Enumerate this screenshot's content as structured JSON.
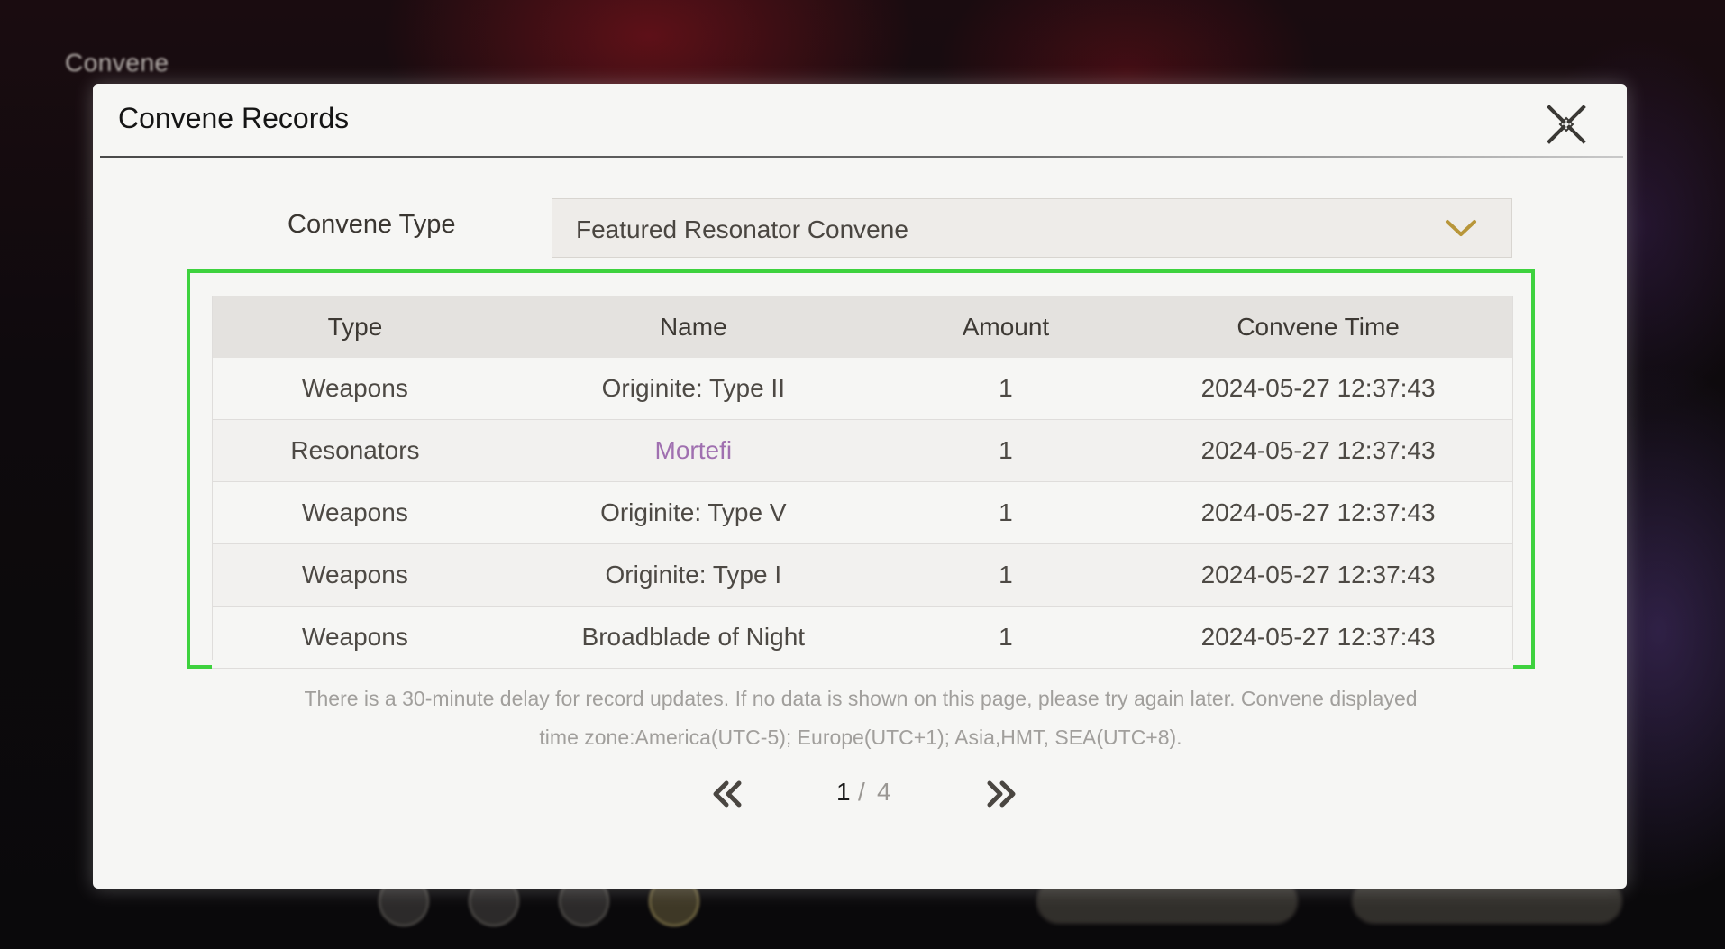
{
  "background": {
    "title": "Convene"
  },
  "dialog": {
    "title": "Convene Records",
    "close_icon": "close-icon"
  },
  "filter": {
    "label": "Convene Type",
    "selected": "Featured Resonator Convene",
    "dropdown_icon": "chevron-down-icon"
  },
  "table": {
    "columns": [
      "Type",
      "Name",
      "Amount",
      "Convene Time"
    ],
    "rows": [
      {
        "type": "Weapons",
        "name": "Originite: Type II",
        "amount": "1",
        "time": "2024-05-27 12:37:43",
        "name_color": "#4d4944"
      },
      {
        "type": "Resonators",
        "name": "Mortefi",
        "amount": "1",
        "time": "2024-05-27 12:37:43",
        "name_color": "#a070b0"
      },
      {
        "type": "Weapons",
        "name": "Originite: Type V",
        "amount": "1",
        "time": "2024-05-27 12:37:43",
        "name_color": "#4d4944"
      },
      {
        "type": "Weapons",
        "name": "Originite: Type I",
        "amount": "1",
        "time": "2024-05-27 12:37:43",
        "name_color": "#4d4944"
      },
      {
        "type": "Weapons",
        "name": "Broadblade of Night",
        "amount": "1",
        "time": "2024-05-27 12:37:43",
        "name_color": "#4d4944"
      }
    ]
  },
  "notice": {
    "line1": "There is a 30-minute delay for record updates. If no data is shown on this page, please try again later. Convene displayed",
    "line2": "time zone:America(UTC-5); Europe(UTC+1); Asia,HMT, SEA(UTC+8)."
  },
  "pagination": {
    "current": "1",
    "separator": "/",
    "total": "4",
    "prev_icon": "double-chevron-left-icon",
    "next_icon": "double-chevron-right-icon"
  },
  "colors": {
    "highlight": "#3ed23e",
    "accent_gold": "#b8963a",
    "rarity_purple": "#a070b0"
  }
}
